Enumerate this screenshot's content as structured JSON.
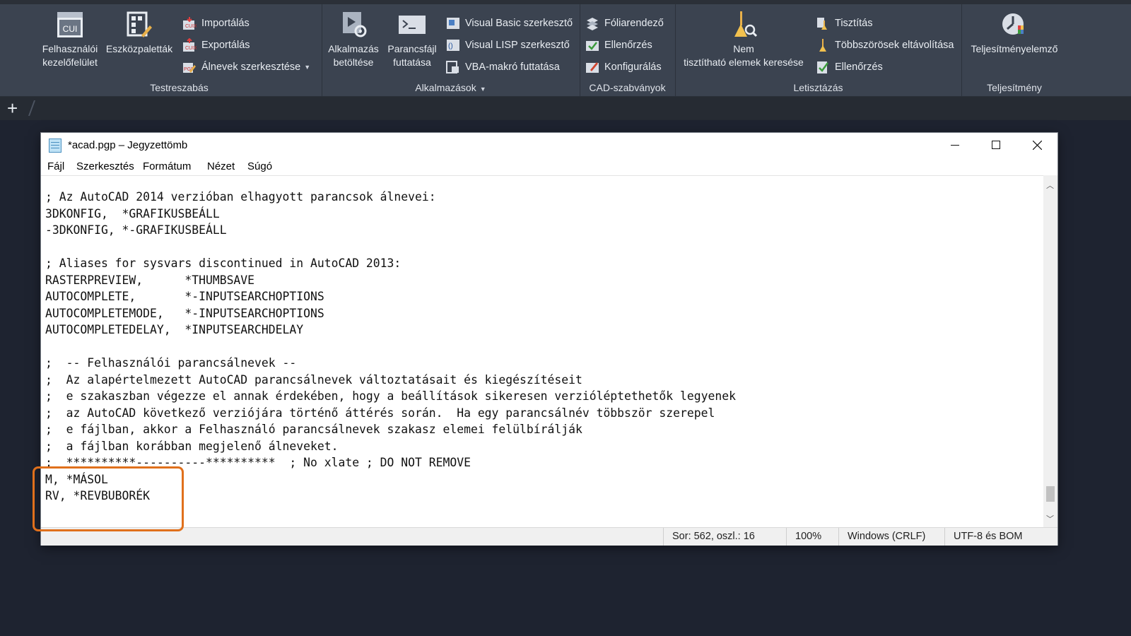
{
  "ribbon": {
    "panels": {
      "testreszabas": {
        "title": "Testreszabás",
        "cui": {
          "icon_text": "CUI",
          "label1": "Felhasználói",
          "label2": "kezelőfelület"
        },
        "tool_palettes": {
          "label": "Eszközpaletták"
        },
        "import": "Importálás",
        "export": "Exportálás",
        "alias_edit": "Álnevek szerkesztése"
      },
      "alkalmazasok": {
        "title": "Alkalmazások",
        "load_app": {
          "label1": "Alkalmazás",
          "label2": "betöltése"
        },
        "run_script": {
          "label1": "Parancsfájl",
          "label2": "futtatása"
        },
        "vb_editor": "Visual Basic szerkesztő",
        "vlisp_editor": "Visual LISP szerkesztő",
        "vba_run": "VBA-makró futtatása"
      },
      "cad_standards": {
        "title": "CAD-szabványok",
        "layer_translator": "Fóliarendező",
        "check": "Ellenőrzés",
        "configure": "Konfigurálás"
      },
      "cleanup": {
        "title": "Letisztázás",
        "find_nonpurgeable": {
          "label1": "Nem",
          "label2": "tisztítható elemek keresése"
        },
        "purge": "Tisztítás",
        "overkill": "Többszörösek eltávolítása",
        "audit": "Ellenőrzés"
      },
      "performance": {
        "title": "Teljesítmény",
        "analyzer": "Teljesítményelemző"
      }
    }
  },
  "tabs": {
    "new_tab": "+"
  },
  "notepad": {
    "title": "*acad.pgp – Jegyzettömb",
    "menu": [
      "Fájl",
      "Szerkesztés",
      "Formátum",
      "Nézet",
      "Súgó"
    ],
    "content": "; Az AutoCAD 2014 verzióban elhagyott parancsok álnevei:\n3DKONFIG,  *GRAFIKUSBEÁLL\n-3DKONFIG, *-GRAFIKUSBEÁLL\n\n; Aliases for sysvars discontinued in AutoCAD 2013:\nRASTERPREVIEW,      *THUMBSAVE\nAUTOCOMPLETE,       *-INPUTSEARCHOPTIONS\nAUTOCOMPLETEMODE,   *-INPUTSEARCHOPTIONS\nAUTOCOMPLETEDELAY,  *INPUTSEARCHDELAY\n\n;  -- Felhasználói parancsálnevek --\n;  Az alapértelmezett AutoCAD parancsálnevek változtatásait és kiegészítéseit\n;  e szakaszban végezze el annak érdekében, hogy a beállítások sikeresen verzióléptethetők legyenek\n;  az AutoCAD következő verziójára történő áttérés során.  Ha egy parancsálnév többször szerepel\n;  e fájlban, akkor a Felhasználó parancsálnevek szakasz elemei felülbírálják\n;  a fájlban korábban megjelenő álneveket.\n;  **********----------**********  ; No xlate ; DO NOT REMOVE\nM, *MÁSOL\nRV, *REVBUBORÉK",
    "status": {
      "position": "Sor: 562, oszl.: 16",
      "zoom": "100%",
      "line_endings": "Windows (CRLF)",
      "encoding": "UTF-8 és BOM"
    }
  },
  "colors": {
    "ribbon_bg": "#3b4350",
    "highlight": "#e0701c"
  }
}
